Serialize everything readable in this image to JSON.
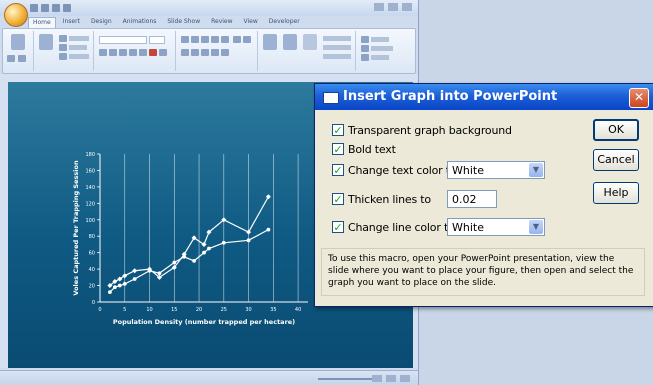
{
  "powerpoint": {
    "window_title": "",
    "tabs": [
      "Home",
      "Insert",
      "Design",
      "Animations",
      "Slide Show",
      "Review",
      "View",
      "Developer"
    ],
    "active_tab": "Home",
    "status_text": "",
    "slide_bg": "#0f5a83"
  },
  "chart_data": {
    "type": "scatter",
    "title": "",
    "xlabel": "Population Density (number trapped per hectare)",
    "ylabel": "Voles Captured Per Trapping Session",
    "x_ticks": [
      "0",
      "5",
      "10",
      "15",
      "20",
      "25",
      "30",
      "35",
      "40"
    ],
    "y_ticks": [
      "0",
      "20",
      "40",
      "60",
      "80",
      "100",
      "120",
      "140",
      "160",
      "180"
    ],
    "xlim": [
      0,
      42
    ],
    "ylim": [
      0,
      180
    ],
    "grid": "vertical",
    "series": [
      {
        "x": [
          2,
          3,
          4,
          5,
          7,
          10,
          12,
          15,
          17,
          19,
          21,
          22,
          25,
          30,
          34
        ],
        "values": [
          12,
          18,
          20,
          22,
          28,
          38,
          35,
          48,
          55,
          50,
          60,
          65,
          72,
          75,
          88
        ],
        "marker": "circle"
      },
      {
        "x": [
          2,
          3,
          4,
          5,
          7,
          10,
          12,
          15,
          17,
          19,
          21,
          22,
          25,
          30,
          34
        ],
        "values": [
          20,
          25,
          28,
          32,
          38,
          40,
          30,
          42,
          58,
          78,
          70,
          85,
          100,
          85,
          128
        ],
        "marker": "diamond"
      }
    ]
  },
  "dialog": {
    "title": "Insert Graph into PowerPoint",
    "close_glyph": "✕",
    "transparent_bg": {
      "label": "Transparent graph background",
      "checked": "✓"
    },
    "bold_text": {
      "label": "Bold text",
      "checked": "✓"
    },
    "change_text_color": {
      "label": "Change text color to",
      "checked": "✓",
      "value": "White"
    },
    "thicken_lines": {
      "label": "Thicken lines to",
      "checked": "✓",
      "value": "0.02"
    },
    "change_line_color": {
      "label": "Change line color to",
      "checked": "✓",
      "value": "White"
    },
    "dropdown_glyph": "▼",
    "ok_label": "OK",
    "cancel_label": "Cancel",
    "help_label": "Help",
    "info_text": "To use this macro, open your PowerPoint presentation, view the slide where you want to place your figure, then open and select the graph you want to place on the slide."
  }
}
